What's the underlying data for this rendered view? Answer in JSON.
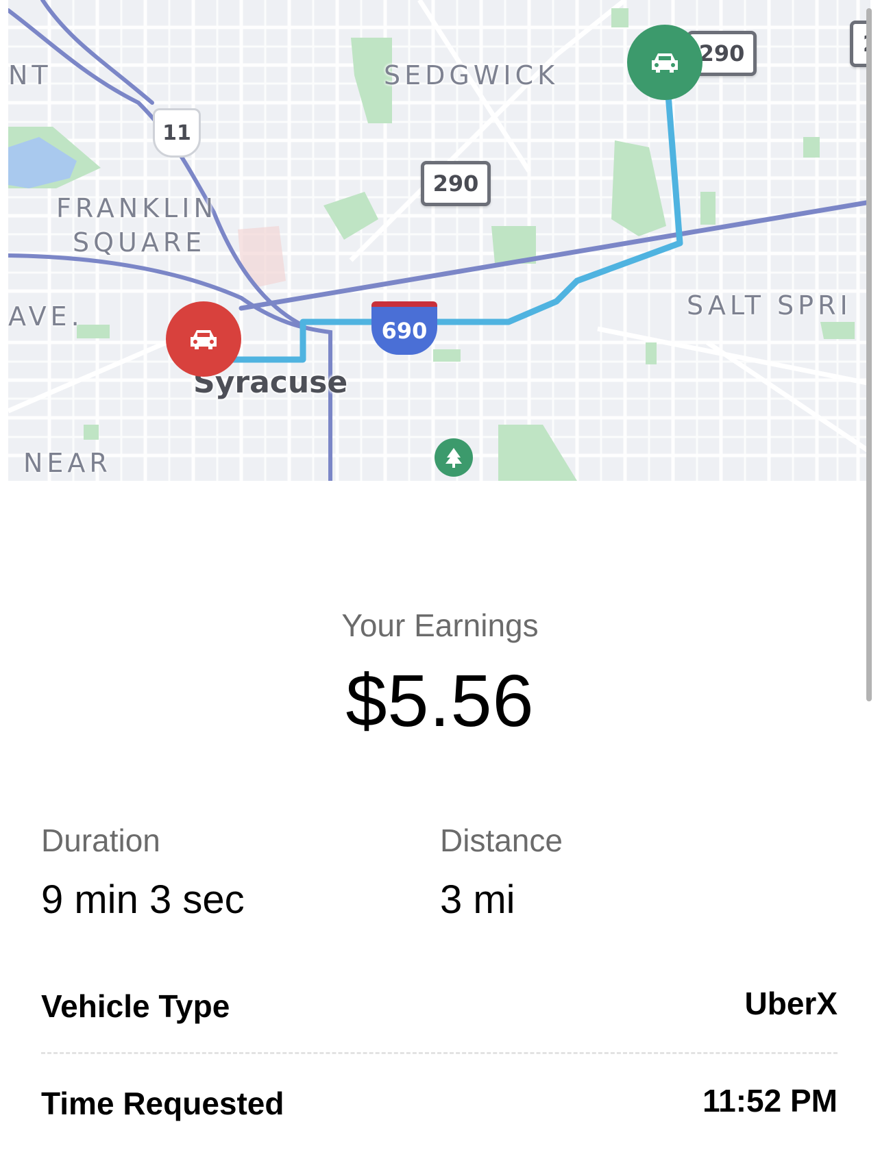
{
  "map": {
    "neighborhood_labels": [
      "NT",
      "SEDGWICK",
      "FRANKLIN",
      "SQUARE",
      "AVE.",
      "SALT SPRI",
      "NEAR"
    ],
    "city_label": "Syracuse",
    "route_shields": {
      "us_route": "11",
      "state_route_a": "290",
      "state_route_b": "290",
      "interstate": "690",
      "partial_shield": "2"
    },
    "start_pin_icon": "car-icon",
    "end_pin_icon": "car-icon",
    "park_icon": "tree-icon",
    "colors": {
      "start_pin": "#d8413d",
      "end_pin": "#3c9a6c",
      "route_line": "#4fb3e0",
      "highway": "#7b86c7",
      "park": "#bfe4c4"
    }
  },
  "earnings": {
    "label": "Your Earnings",
    "value": "$5.56"
  },
  "stats": {
    "duration_label": "Duration",
    "duration_value": "9 min 3 sec",
    "distance_label": "Distance",
    "distance_value": "3 mi"
  },
  "details": {
    "vehicle_type_label": "Vehicle Type",
    "vehicle_type_value": "UberX",
    "time_requested_label": "Time Requested",
    "time_requested_value": "11:52 PM"
  }
}
